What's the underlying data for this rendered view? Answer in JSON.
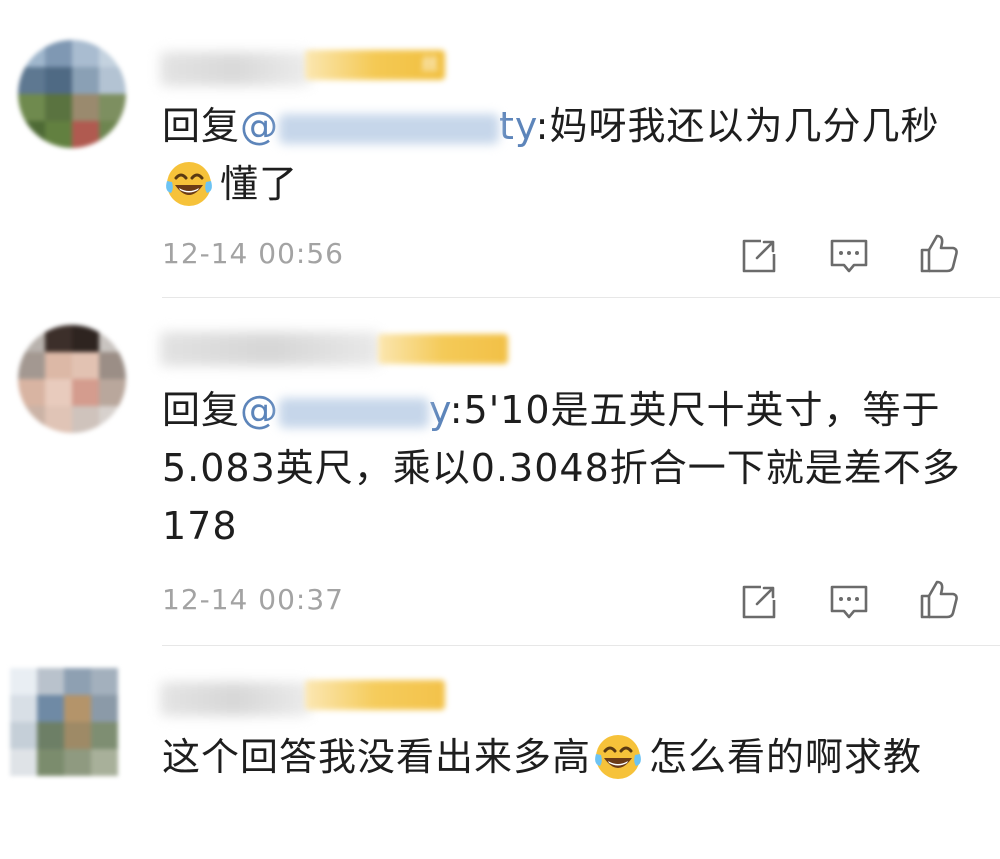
{
  "comments": [
    {
      "reply_prefix": "回复",
      "mention_at": "@",
      "mention_tail": "ty",
      "body_part1": ":妈呀我还以为几分几秒",
      "body_part2": "懂了",
      "timestamp": "12-14 00:56",
      "badge_text": "丝"
    },
    {
      "reply_prefix": "回复",
      "mention_at": "@",
      "mention_tail": "y",
      "body_part1": ":5'10是五英尺十英寸，等于5.083英尺，乘以0.3048折合一下就是差不多178",
      "timestamp": "12-14 00:37"
    },
    {
      "body_part1": "这个回答我没看出来多高",
      "body_part2": "怎么看的啊求教"
    }
  ],
  "icons": {
    "share": "share-icon",
    "reply": "reply-comment-icon",
    "like": "thumbs-up-icon",
    "emoji": "laughing-tears-emoji"
  },
  "colors": {
    "mention": "#5d85ba",
    "timestamp": "#a3a3a3",
    "badge": "#f3c44f",
    "icon": "#6b6b6b"
  }
}
